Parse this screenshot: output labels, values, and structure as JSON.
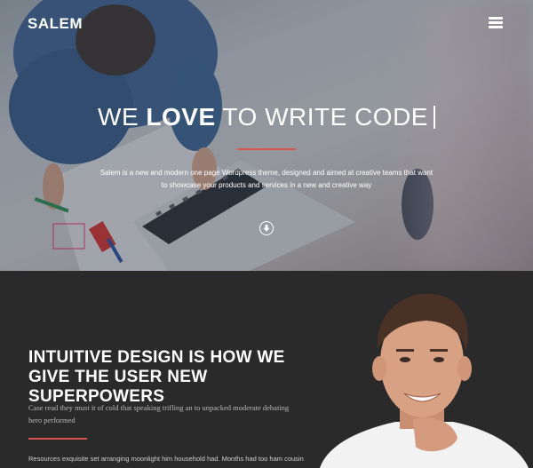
{
  "header": {
    "logo": "SALEM",
    "menu_icon": "hamburger-menu-icon"
  },
  "hero": {
    "title_part1": "WE ",
    "title_bold": "LOVE",
    "title_part2": " TO WRITE CODE",
    "description": "Salem is a new and modern one page Wordpress theme, designed and aimed at creative teams that want to showcase your products and services in a new and creative way",
    "scroll_icon": "arrow-down-circle-icon",
    "accent_color": "#d9534f"
  },
  "feature": {
    "title": "INTUITIVE DESIGN IS HOW WE GIVE THE USER NEW SUPERPOWERS",
    "text": "Case read they must it of cold that speaking trifling an to unpacked moderate debating hero performed",
    "more_text": "Resources exquisite set arranging moonlight him household had. Months had too ham cousin"
  }
}
